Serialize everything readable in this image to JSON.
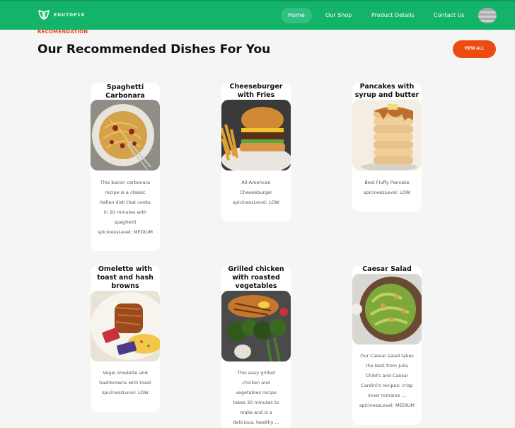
{
  "nav": {
    "logo_text": "EDUTOP18",
    "items": [
      {
        "label": "Home"
      },
      {
        "label": "Our Shop"
      },
      {
        "label": "Product Details"
      },
      {
        "label": "Contact Us"
      }
    ]
  },
  "section": {
    "eyebrow": "RECOMENDATION",
    "title": "Our Recommended Dishes For You",
    "view_all_label": "VIEW ALL"
  },
  "cards": [
    {
      "title": "Spaghetti Carbonara",
      "description": [
        "This bacon carbonara",
        "recipe is a classic",
        "Italian dish that cooks",
        "in 20 minutes with",
        "spaghetti",
        "spicinessLevel: MEDIUM"
      ]
    },
    {
      "title": "Cheeseburger with Fries",
      "description": [
        "All-American",
        "Cheeseburger",
        "spicinessLevel: LOW"
      ]
    },
    {
      "title": "Pancakes with syrup and butter",
      "description": [
        "Best Fluffy Pancake",
        "spicinessLevel: LOW"
      ]
    },
    {
      "title": "Omelette with toast and hash browns",
      "description": [
        "Vegie omelette and",
        "hashbrowns with toast",
        "spicinessLevel: LOW"
      ]
    },
    {
      "title": "Grilled chicken with roasted vegetables",
      "description": [
        "This easy grilled",
        "chicken and",
        "vegetables recipe",
        "takes 30 minutes to",
        "make and is a",
        "delicious, healthy ..."
      ]
    },
    {
      "title": "Caesar Salad",
      "description": [
        "Our Caesar salad takes",
        "the best from Julia",
        "Child's and Caesar",
        "Cardini's recipes: crisp",
        "inner romaine ...",
        "spicinessLevel: MEDIUM"
      ]
    }
  ]
}
